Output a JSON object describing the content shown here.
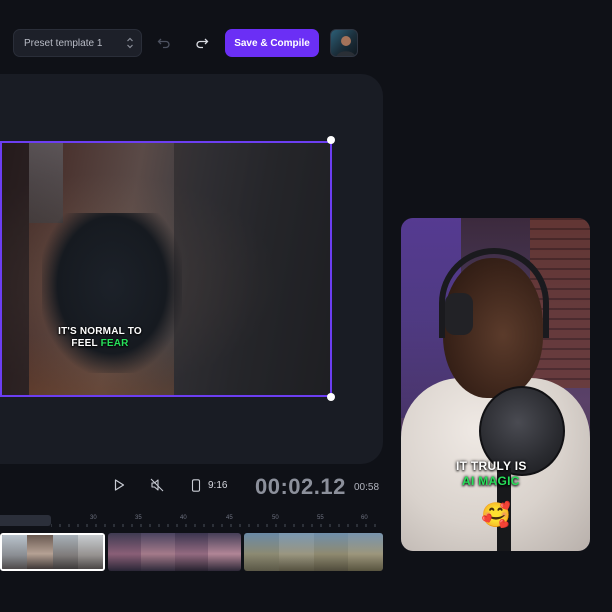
{
  "toolbar": {
    "preset_value": "Preset template 1",
    "save_label": "Save & Compile"
  },
  "canvas": {
    "caption_line1": "IT'S NORMAL TO",
    "caption_line2_prefix": "FEEL ",
    "caption_line2_accent": "FEAR",
    "accent_color": "#27e05a",
    "selection_color": "#6c3ef2"
  },
  "playback": {
    "aspect_ratio": "9:16",
    "current_time": "00:02.12",
    "total_time": "00:58"
  },
  "timeline": {
    "ruler_labels": [
      "30",
      "35",
      "40",
      "45",
      "50",
      "55",
      "60"
    ]
  },
  "side_preview": {
    "caption_line1": "IT TRULY IS",
    "caption_line2": "AI MAGIC",
    "emoji": "🥰"
  },
  "colors": {
    "brand": "#6b2ff5",
    "background": "#0f1117",
    "panel": "#191c24"
  }
}
